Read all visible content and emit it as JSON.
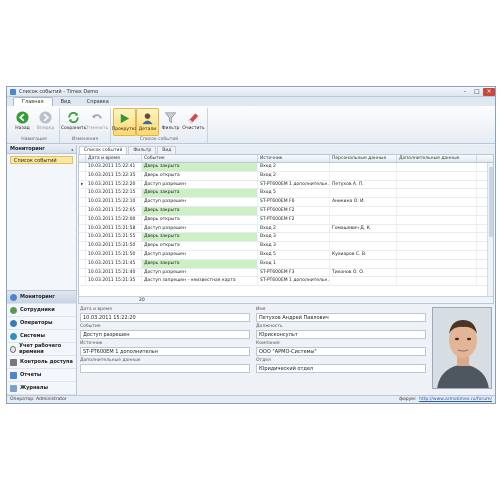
{
  "window": {
    "title": "Список событий - Timex Demo"
  },
  "ribbon": {
    "tabs": [
      "Главная",
      "Вид",
      "Справка"
    ],
    "groups": [
      {
        "label": "Навигация",
        "buttons": [
          {
            "label": "Назад",
            "icon": "arrow-left-icon",
            "state": "normal"
          },
          {
            "label": "Вперед",
            "icon": "arrow-right-icon",
            "state": "disabled"
          }
        ]
      },
      {
        "label": "Изменения",
        "buttons": [
          {
            "label": "Сохранить",
            "icon": "refresh-save-icon",
            "state": "normal"
          },
          {
            "label": "Отменить",
            "icon": "undo-icon",
            "state": "disabled"
          }
        ]
      },
      {
        "label": "Список событий",
        "buttons": [
          {
            "label": "Прокрутка",
            "icon": "play-icon",
            "state": "active"
          },
          {
            "label": "Детали",
            "icon": "person-details-icon",
            "state": "active"
          },
          {
            "label": "Фильтр",
            "icon": "filter-icon",
            "state": "normal"
          },
          {
            "label": "Очистить",
            "icon": "eraser-icon",
            "state": "normal"
          }
        ]
      }
    ]
  },
  "sidebar": {
    "header": "Мониторинг",
    "selected_item": "Список событий",
    "nav": [
      "Мониторинг",
      "Сотрудники",
      "Операторы",
      "Системы",
      "Учет рабочего времени",
      "Контроль доступа",
      "Отчеты",
      "Журналы"
    ]
  },
  "tabs": [
    "Список событий",
    "Фильтр",
    "Вид"
  ],
  "grid": {
    "columns": [
      "Дата и время",
      "Событие",
      "Источник",
      "Персональные данные",
      "Дополнительные данные"
    ],
    "rows": [
      {
        "date": "10.03.2011 15:22:41",
        "event": "Дверь закрыта",
        "source": "Вход 2",
        "person": "",
        "extra": "",
        "green": true
      },
      {
        "date": "10.03.2011 15:22:35",
        "event": "Дверь открыта",
        "source": "Вход 2",
        "person": "",
        "extra": "",
        "green": false
      },
      {
        "date": "10.03.2011 15:22:20",
        "event": "Доступ разрешен",
        "source": "ST-PT600EM 1 дополнительн...",
        "person": "Петухов А. П.",
        "extra": "",
        "green": false,
        "current": true
      },
      {
        "date": "10.03.2011 15:22:15",
        "event": "Дверь закрыта",
        "source": "Вход 5",
        "person": "",
        "extra": "",
        "green": true
      },
      {
        "date": "10.03.2011 15:22:10",
        "event": "Доступ разрешен",
        "source": "ST-PT600EM F6",
        "person": "Аникина О. И.",
        "extra": "",
        "green": false
      },
      {
        "date": "10.03.2011 15:22:05",
        "event": "Дверь закрыта",
        "source": "ST-PT600EM F2",
        "person": "",
        "extra": "",
        "green": true
      },
      {
        "date": "10.03.2011 15:22:00",
        "event": "Дверь открыта",
        "source": "ST-PT600EM F2",
        "person": "",
        "extra": "",
        "green": false
      },
      {
        "date": "10.03.2011 15:21:58",
        "event": "Доступ разрешен",
        "source": "Вход 2",
        "person": "Гомашевич Д. К.",
        "extra": "",
        "green": false
      },
      {
        "date": "10.03.2011 15:21:55",
        "event": "Дверь закрыта",
        "source": "Вход 3",
        "person": "",
        "extra": "",
        "green": true
      },
      {
        "date": "10.03.2011 15:21:50",
        "event": "Дверь открыта",
        "source": "Вход 3",
        "person": "",
        "extra": "",
        "green": false
      },
      {
        "date": "10.03.2011 15:21:50",
        "event": "Доступ разрешен",
        "source": "Вход 5",
        "person": "Кухиаров С. В.",
        "extra": "",
        "green": false
      },
      {
        "date": "10.03.2011 15:21:45",
        "event": "Дверь закрыта",
        "source": "Вход 1",
        "person": "",
        "extra": "",
        "green": true
      },
      {
        "date": "10.03.2011 15:21:40",
        "event": "Доступ разрешен",
        "source": "ST-PT600EM F3",
        "person": "Тихонов О. О.",
        "extra": "",
        "green": false
      },
      {
        "date": "10.03.2011 15:21:35",
        "event": "Доступ запрещен - неизвестная карта",
        "source": "ST-PT600EM 1 дополнительн...",
        "person": "",
        "extra": "",
        "green": false
      }
    ],
    "footer_count": "20"
  },
  "details": {
    "date_label": "Дата и время",
    "date": "10.03.2011 15:22:20",
    "event_label": "Событие",
    "event": "Доступ разрешен",
    "source_label": "Источник",
    "source": "ST-PT600EM 1 дополнительн",
    "extra_label": "Дополнительные данные",
    "extra": "",
    "name_label": "Имя",
    "name": "Петухов Андрей Павлович",
    "position_label": "Должность",
    "position": "Юрисконсульт",
    "company_label": "Компания",
    "company": "ООО \"АРМО-Системы\"",
    "dept_label": "Отдел",
    "dept": "Юридический отдел"
  },
  "status": {
    "operator": "Оператор: Administrator",
    "forum_label": "форум:",
    "forum_link": "http://www.armotimex.ru/forum/"
  },
  "colors": {
    "accent": "#ffd86b",
    "green_row": "#ccf0c4",
    "frame": "#8aa0bb"
  }
}
